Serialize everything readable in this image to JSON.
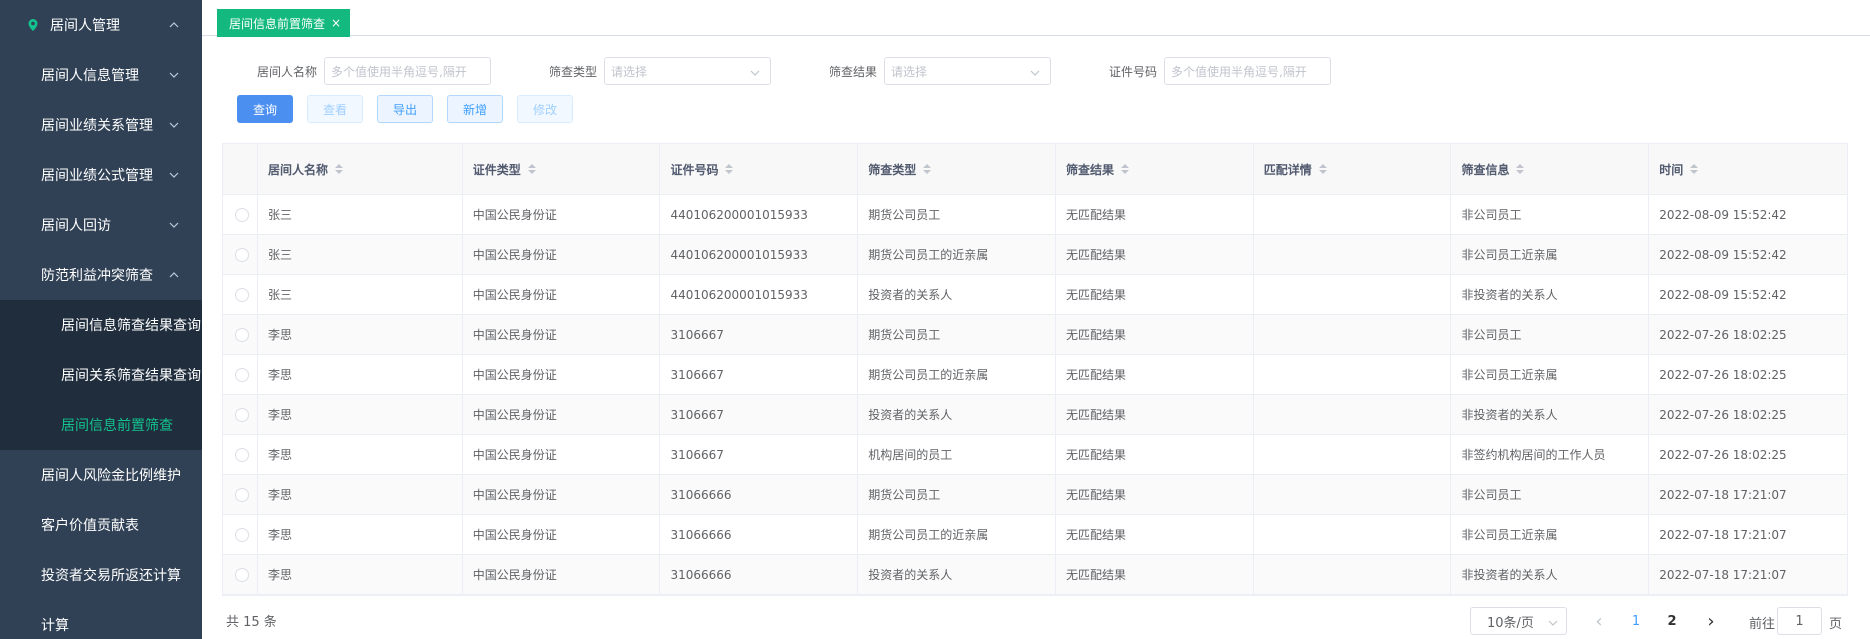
{
  "sidebar": {
    "top_item": "居间人管理",
    "items": [
      {
        "label": "居间人信息管理"
      },
      {
        "label": "居间业绩关系管理"
      },
      {
        "label": "居间业绩公式管理"
      },
      {
        "label": "居间人回访"
      },
      {
        "label": "防范利益冲突筛查"
      }
    ],
    "submenu": [
      {
        "label": "居间信息筛查结果查询"
      },
      {
        "label": "居间关系筛查结果查询"
      },
      {
        "label": "居间信息前置筛查"
      }
    ],
    "items_after": [
      {
        "label": "居间人风险金比例维护"
      },
      {
        "label": "客户价值贡献表"
      },
      {
        "label": "投资者交易所返还计算"
      },
      {
        "label": "计算"
      }
    ],
    "active_color": "#13c28d"
  },
  "tabs": {
    "active": "居间信息前置筛查",
    "close": "×"
  },
  "filter": {
    "name_label": "居间人名称",
    "name_placeholder": "多个值使用半角逗号,隔开",
    "type_label": "筛查类型",
    "type_placeholder": "请选择",
    "result_label": "筛查结果",
    "result_placeholder": "请选择",
    "id_label": "证件号码",
    "id_placeholder": "多个值使用半角逗号,隔开"
  },
  "buttons": {
    "query": "查询",
    "view": "查看",
    "export": "导出",
    "add": "新增",
    "edit": "修改"
  },
  "table": {
    "headers": [
      "居间人名称",
      "证件类型",
      "证件号码",
      "筛查类型",
      "筛查结果",
      "匹配详情",
      "筛查信息",
      "时间"
    ],
    "rows": [
      [
        "张三",
        "中国公民身份证",
        "440106200001015933",
        "期货公司员工",
        "无匹配结果",
        "",
        "非公司员工",
        "2022-08-09 15:52:42"
      ],
      [
        "张三",
        "中国公民身份证",
        "440106200001015933",
        "期货公司员工的近亲属",
        "无匹配结果",
        "",
        "非公司员工近亲属",
        "2022-08-09 15:52:42"
      ],
      [
        "张三",
        "中国公民身份证",
        "440106200001015933",
        "投资者的关系人",
        "无匹配结果",
        "",
        "非投资者的关系人",
        "2022-08-09 15:52:42"
      ],
      [
        "李思",
        "中国公民身份证",
        "3106667",
        "期货公司员工",
        "无匹配结果",
        "",
        "非公司员工",
        "2022-07-26 18:02:25"
      ],
      [
        "李思",
        "中国公民身份证",
        "3106667",
        "期货公司员工的近亲属",
        "无匹配结果",
        "",
        "非公司员工近亲属",
        "2022-07-26 18:02:25"
      ],
      [
        "李思",
        "中国公民身份证",
        "3106667",
        "投资者的关系人",
        "无匹配结果",
        "",
        "非投资者的关系人",
        "2022-07-26 18:02:25"
      ],
      [
        "李思",
        "中国公民身份证",
        "3106667",
        "机构居间的员工",
        "无匹配结果",
        "",
        "非签约机构居间的工作人员",
        "2022-07-26 18:02:25"
      ],
      [
        "李思",
        "中国公民身份证",
        "31066666",
        "期货公司员工",
        "无匹配结果",
        "",
        "非公司员工",
        "2022-07-18 17:21:07"
      ],
      [
        "李思",
        "中国公民身份证",
        "31066666",
        "期货公司员工的近亲属",
        "无匹配结果",
        "",
        "非公司员工近亲属",
        "2022-07-18 17:21:07"
      ],
      [
        "李思",
        "中国公民身份证",
        "31066666",
        "投资者的关系人",
        "无匹配结果",
        "",
        "非投资者的关系人",
        "2022-07-18 17:21:07"
      ]
    ]
  },
  "pagination": {
    "total": "共 15 条",
    "page_size": "10条/页",
    "prev": "‹",
    "pages": [
      "1",
      "2"
    ],
    "current": "1",
    "next": "›",
    "goto_label": "前往",
    "goto_value": "1",
    "goto_suffix": "页"
  }
}
